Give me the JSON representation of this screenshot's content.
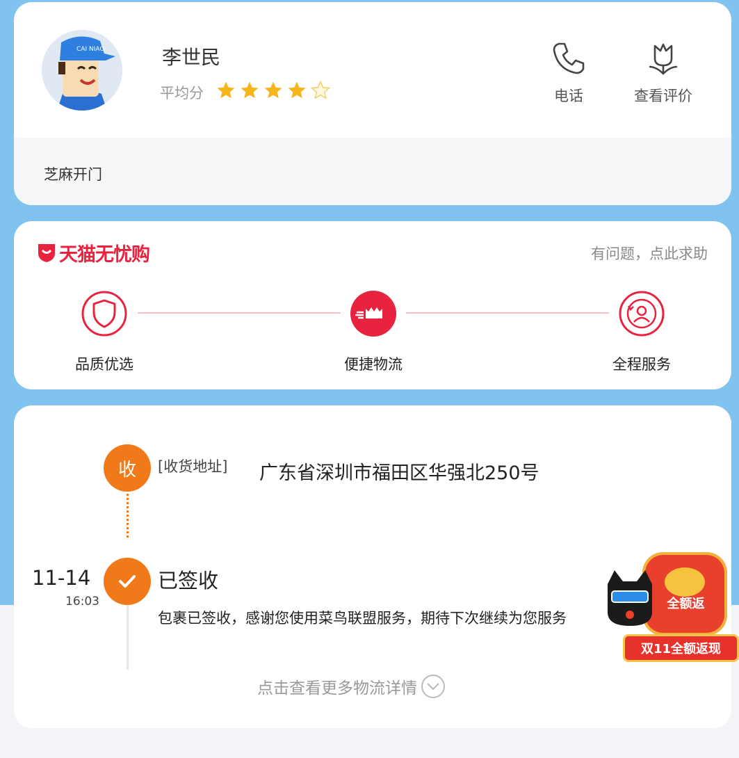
{
  "courier": {
    "name": "李世民",
    "rating_label": "平均分",
    "rating": 4,
    "rating_max": 5,
    "call_label": "电话",
    "review_label": "查看评价",
    "sesame_text": "芝麻开门",
    "avatar_cap_text": "CAI NIAO"
  },
  "tmall": {
    "title": "天猫无忧购",
    "help_text": "有问题，点此求助",
    "features": [
      {
        "label": "品质优选",
        "icon": "shield-icon"
      },
      {
        "label": "便捷物流",
        "icon": "delivery-icon"
      },
      {
        "label": "全程服务",
        "icon": "service-person-icon"
      }
    ],
    "brand_color": "#e8233f"
  },
  "tracking": {
    "receive_node_text": "收",
    "address_label": "[收货地址]",
    "address": "广东省深圳市福田区华强北250号",
    "date": "11-14",
    "time": "16:03",
    "status": "已签收",
    "detail": "包裹已签收，感谢您使用菜鸟联盟服务，期待下次继续为您服务",
    "more_text": "点击查看更多物流详情",
    "accent_color": "#f07a1a"
  },
  "promo": {
    "top_text": "全额返",
    "banner_text": "双11全额返现"
  }
}
